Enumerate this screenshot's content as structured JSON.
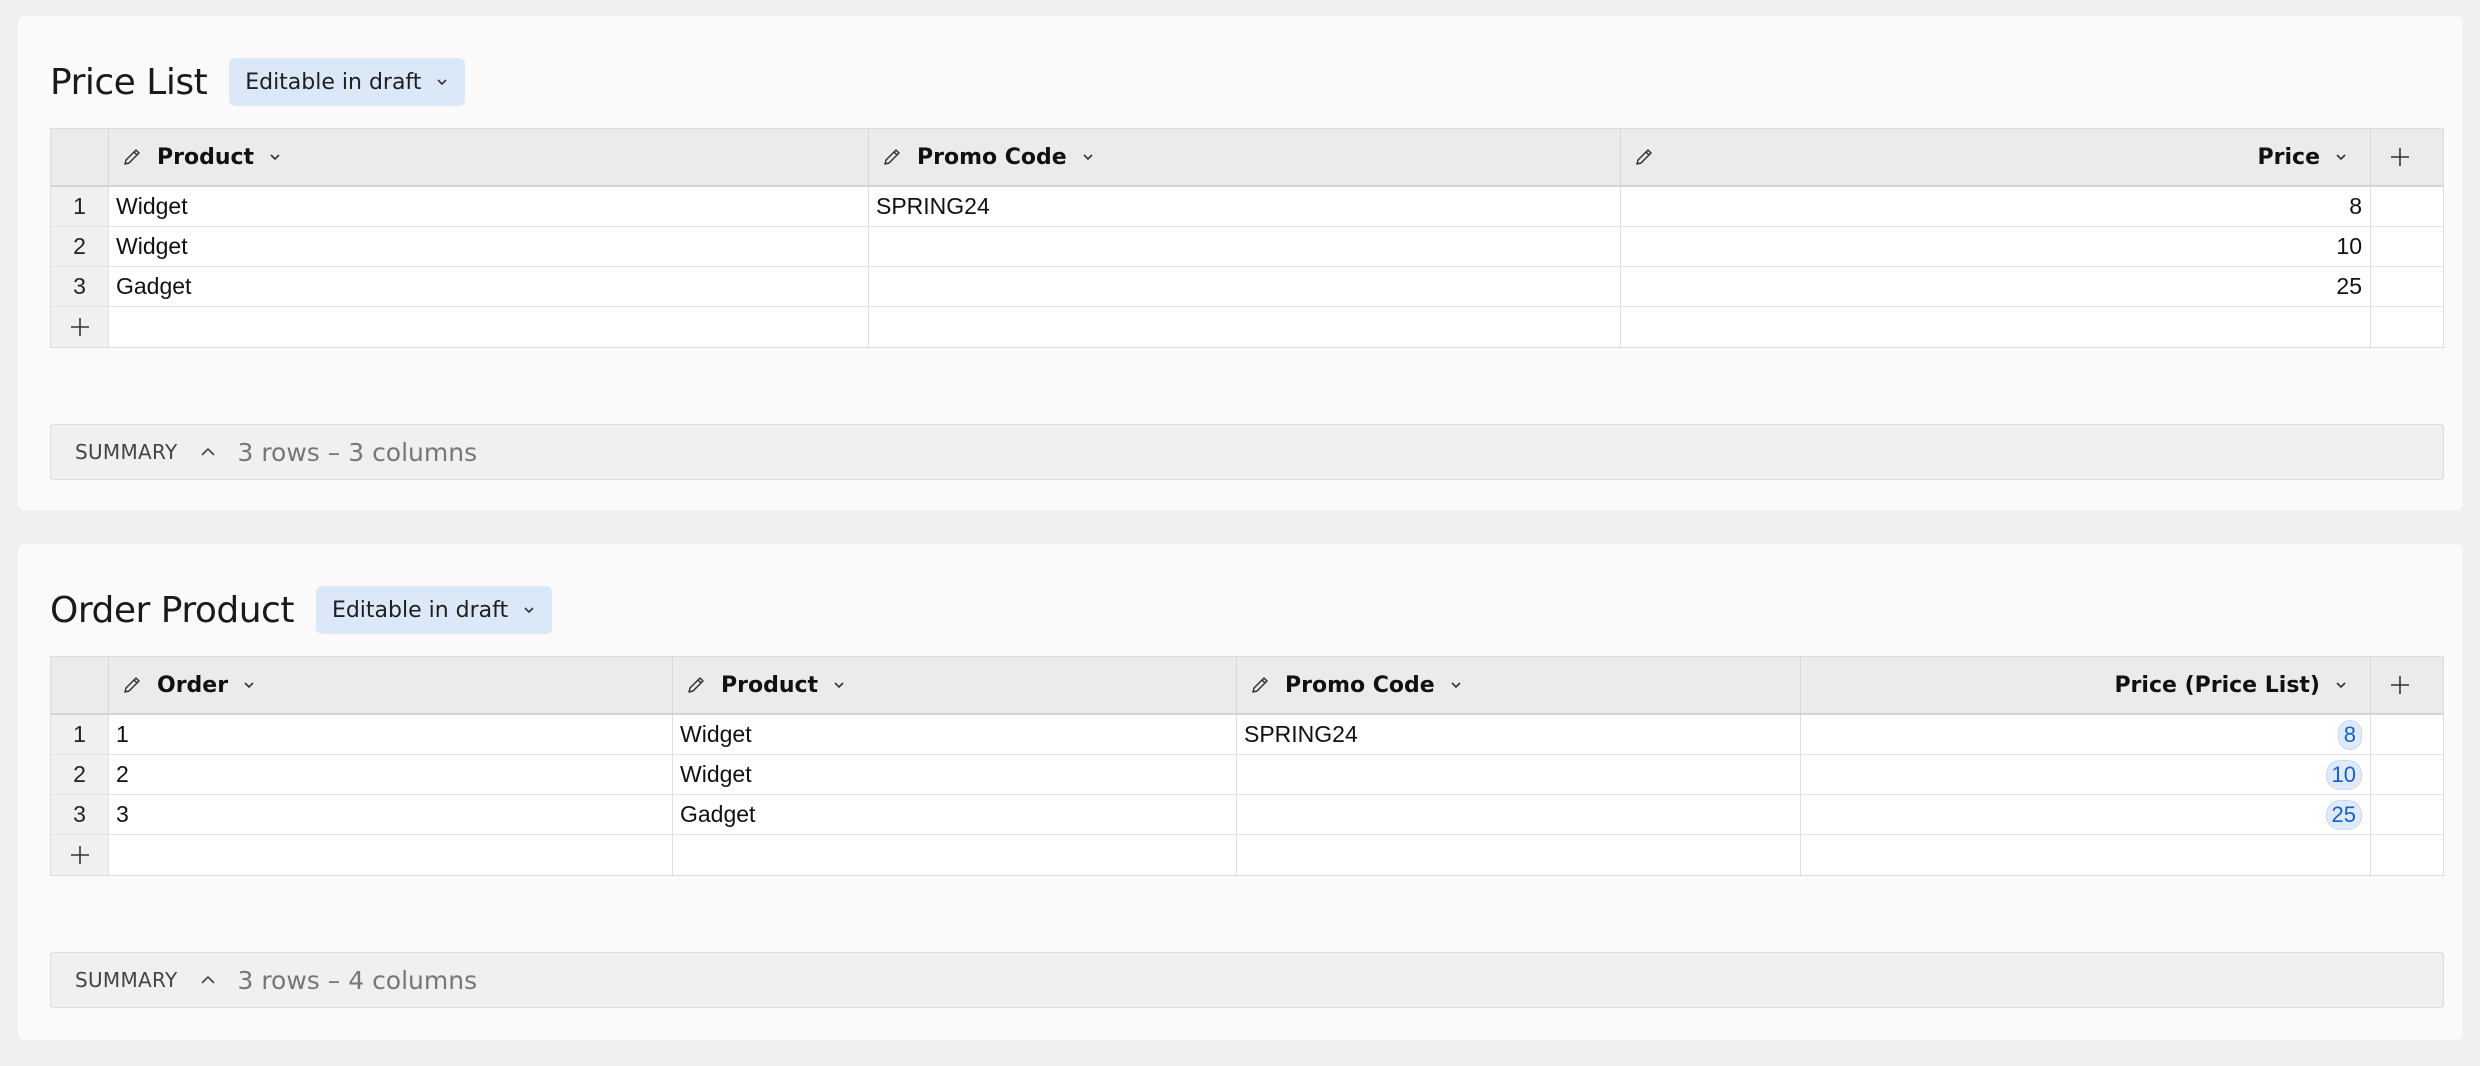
{
  "price_list": {
    "title": "Price List",
    "badge": "Editable in draft",
    "headers": [
      "Product",
      "Promo Code",
      "Price"
    ],
    "rows": [
      {
        "num": "1",
        "product": "Widget",
        "promo": "SPRING24",
        "price": "8"
      },
      {
        "num": "2",
        "product": "Widget",
        "promo": "",
        "price": "10"
      },
      {
        "num": "3",
        "product": "Gadget",
        "promo": "",
        "price": "25"
      }
    ],
    "summary_label": "SUMMARY",
    "summary_text": "3 rows – 3 columns"
  },
  "order_product": {
    "title": "Order Product",
    "badge": "Editable in draft",
    "headers": [
      "Order",
      "Product",
      "Promo Code",
      "Price (Price List)"
    ],
    "rows": [
      {
        "num": "1",
        "order": "1",
        "product": "Widget",
        "promo": "SPRING24",
        "price": "8"
      },
      {
        "num": "2",
        "order": "2",
        "product": "Widget",
        "promo": "",
        "price": "10"
      },
      {
        "num": "3",
        "order": "3",
        "product": "Gadget",
        "promo": "",
        "price": "25"
      }
    ],
    "summary_label": "SUMMARY",
    "summary_text": "3 rows – 4 columns"
  },
  "colors": {
    "badge_bg": "#dbe8f8",
    "reference_text": "#1a5fc8",
    "reference_bg": "#dfeaf9"
  },
  "icons": [
    "pencil-icon",
    "chevron-down-icon",
    "plus-icon",
    "chevron-up-icon"
  ]
}
